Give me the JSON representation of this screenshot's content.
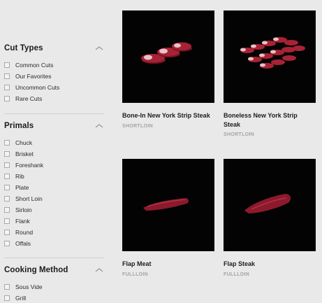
{
  "filters": {
    "cut_types": {
      "title": "Cut Types",
      "options": [
        "Common Cuts",
        "Our Favorites",
        "Uncommon Cuts",
        "Rare Cuts"
      ]
    },
    "primals": {
      "title": "Primals",
      "options": [
        "Chuck",
        "Brisket",
        "Foreshank",
        "Rib",
        "Plate",
        "Short Loin",
        "Sirloin",
        "Flank",
        "Round",
        "Offals"
      ]
    },
    "cooking_method": {
      "title": "Cooking Method",
      "options": [
        "Sous Vide",
        "Grill"
      ]
    }
  },
  "products": [
    {
      "name": "Bone-In New York Strip Steak",
      "category": "SHORTLOIN"
    },
    {
      "name": "Boneless New York Strip Steak",
      "category": "SHORTLOIN"
    },
    {
      "name": "Flap Meat",
      "category": "FULLLOIN"
    },
    {
      "name": "Flap Steak",
      "category": "FULLLOIN"
    }
  ],
  "colors": {
    "background": "#e9e9e9",
    "image_bg": "#030303",
    "meat": "#9a1c2e",
    "fat": "#e6c1c6"
  },
  "icons": {
    "collapse": "chevron-up-icon",
    "checkbox": "checkbox-icon"
  }
}
